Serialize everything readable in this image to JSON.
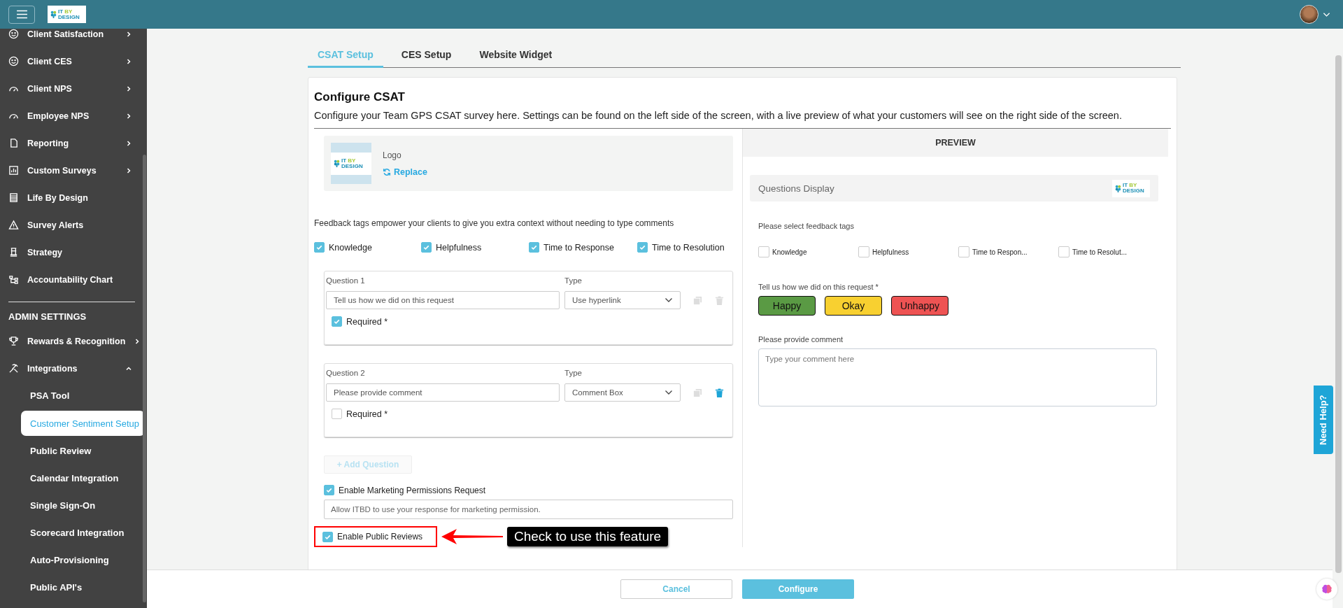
{
  "header": {
    "logo": [
      "IT",
      "BY",
      "DESIGN"
    ]
  },
  "sidebar": {
    "items": [
      {
        "kind": "smile",
        "label": "Client Satisfaction",
        "expanded": false
      },
      {
        "kind": "smile",
        "label": "Client CES",
        "expanded": false
      },
      {
        "kind": "gauge",
        "label": "Client NPS",
        "expanded": false
      },
      {
        "kind": "gauge",
        "label": "Employee NPS",
        "expanded": false
      },
      {
        "kind": "doc",
        "label": "Reporting",
        "expanded": false
      },
      {
        "kind": "chart",
        "label": "Custom Surveys",
        "expanded": false
      },
      {
        "kind": "list",
        "label": "Life By Design"
      },
      {
        "kind": "alert",
        "label": "Survey Alerts"
      },
      {
        "kind": "strategy",
        "label": "Strategy"
      },
      {
        "kind": "org",
        "label": "Accountability Chart"
      }
    ],
    "admin": {
      "title": "ADMIN SETTINGS",
      "items": [
        {
          "kind": "trophy",
          "label": "Rewards & Recognition",
          "expanded": false
        },
        {
          "kind": "tools",
          "label": "Integrations",
          "expanded": true,
          "children": [
            {
              "label": "PSA Tool",
              "selected": false
            },
            {
              "label": "Customer Sentiment Setup",
              "selected": true
            },
            {
              "label": "Public Review",
              "selected": false
            },
            {
              "label": "Calendar Integration",
              "selected": false
            },
            {
              "label": "Single Sign-On",
              "selected": false
            },
            {
              "label": "Scorecard Integration",
              "selected": false
            },
            {
              "label": "Auto-Provisioning",
              "selected": false
            },
            {
              "label": "Public API's",
              "selected": false
            }
          ]
        }
      ]
    }
  },
  "tabs": [
    {
      "label": "CSAT Setup",
      "selected": true
    },
    {
      "label": "CES Setup",
      "selected": false
    },
    {
      "label": "Website Widget",
      "selected": false
    }
  ],
  "config": {
    "title": "Configure CSAT",
    "description": "Configure your Team GPS CSAT survey here. Settings can be found on the left side of the screen, with a live preview of what your customers will see on the right side of the screen.",
    "logo_panel": {
      "label": "Logo",
      "action": "Replace",
      "logo": [
        "IT",
        "BY",
        "DESIGN"
      ]
    },
    "tags_intro": "Feedback tags empower your clients to give you extra context without needing to type comments",
    "tags": [
      {
        "label": "Knowledge",
        "checked": true
      },
      {
        "label": "Helpfulness",
        "checked": true
      },
      {
        "label": "Time to Response",
        "checked": true
      },
      {
        "label": "Time to Resolution",
        "checked": true
      }
    ],
    "questions": [
      {
        "heading": "Question 1",
        "type_label": "Type",
        "value": "Tell us how we did on this request",
        "type": "Use hyperlink",
        "required_label": "Required *",
        "required": true,
        "delete_enabled": false
      },
      {
        "heading": "Question 2",
        "type_label": "Type",
        "value": "Please provide comment",
        "type": "Comment Box",
        "required_label": "Required *",
        "required": false,
        "delete_enabled": true
      }
    ],
    "add_question": {
      "label": "+ Add Question",
      "disabled": true
    },
    "marketing": {
      "label": "Enable Marketing Permissions Request",
      "checked": true,
      "placeholder": "Allow ITBD to use your response for marketing permission."
    },
    "public_reviews": {
      "label": "Enable Public Reviews",
      "checked": true
    },
    "annotation": "Check to use this feature"
  },
  "preview": {
    "title": "PREVIEW",
    "header": "Questions Display",
    "logo": [
      "IT",
      "BY",
      "DESIGN"
    ],
    "tags_prompt": "Please select feedback tags",
    "tags": [
      {
        "label": "Knowledge",
        "checked": false
      },
      {
        "label": "Helpfulness",
        "checked": false
      },
      {
        "label": "Time to Respon...",
        "checked": false
      },
      {
        "label": "Time to Resolut...",
        "checked": false
      }
    ],
    "question": "Tell us how we did on this request *",
    "ratings": [
      {
        "label": "Happy",
        "color": "#5a9a44"
      },
      {
        "label": "Okay",
        "color": "#f8d030"
      },
      {
        "label": "Unhappy",
        "color": "#ee5353"
      }
    ],
    "comment_label": "Please provide comment",
    "comment_placeholder": "Type your comment here"
  },
  "footer": {
    "cancel": "Cancel",
    "configure": "Configure"
  },
  "help": "Need Help?"
}
